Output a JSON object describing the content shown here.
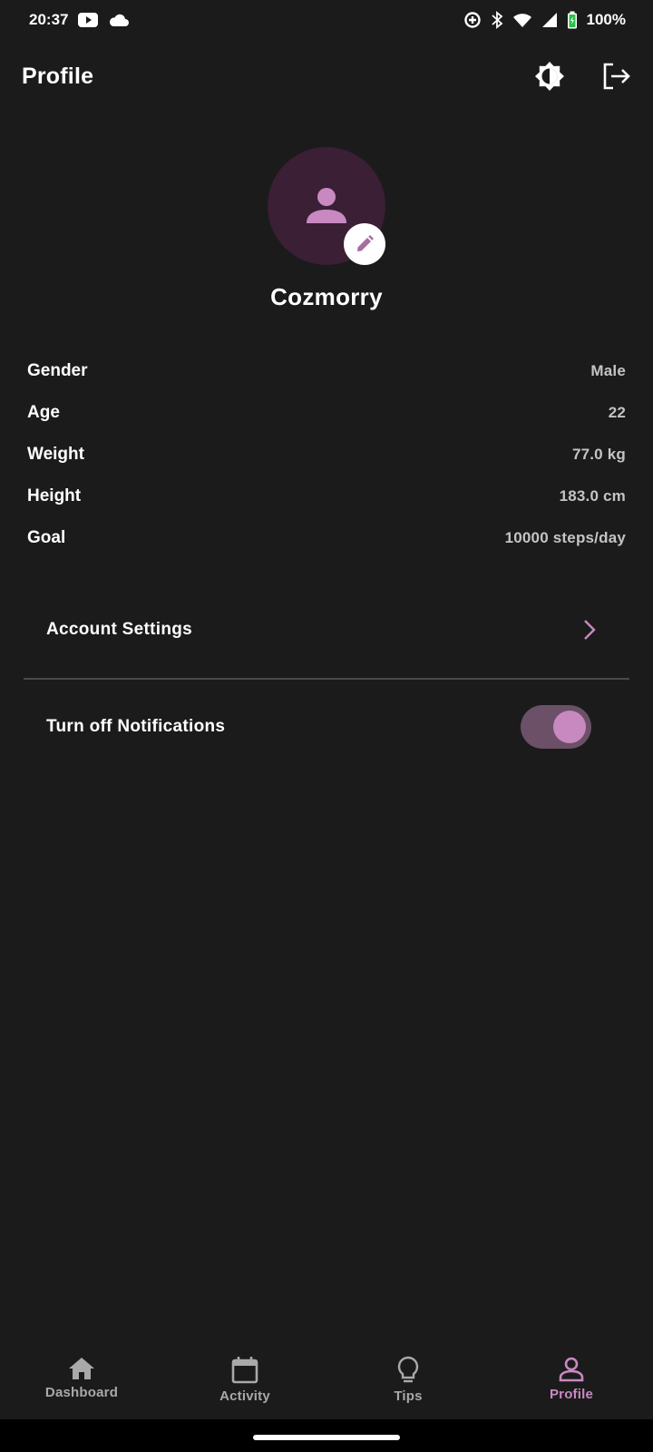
{
  "status_bar": {
    "time": "20:37",
    "battery": "100%",
    "icons_left": [
      "youtube-icon",
      "cloud-icon"
    ],
    "icons_right": [
      "data-saver-icon",
      "bluetooth-icon",
      "wifi-icon",
      "signal-icon",
      "battery-icon"
    ]
  },
  "app_bar": {
    "title": "Profile",
    "actions": [
      "brightness-icon",
      "logout-icon"
    ]
  },
  "profile": {
    "username": "Cozmorry",
    "avatar_icon": "person-icon",
    "edit_icon": "pencil-icon"
  },
  "info": [
    {
      "label": "Gender",
      "value": "Male"
    },
    {
      "label": "Age",
      "value": "22"
    },
    {
      "label": "Weight",
      "value": "77.0 kg"
    },
    {
      "label": "Height",
      "value": "183.0 cm"
    },
    {
      "label": "Goal",
      "value": "10000 steps/day"
    }
  ],
  "settings": {
    "account_label": "Account Settings",
    "notifications_label": "Turn off Notifications",
    "notifications_toggle_on": true
  },
  "bottom_nav": [
    {
      "label": "Dashboard",
      "icon": "home-icon",
      "active": false
    },
    {
      "label": "Activity",
      "icon": "calendar-icon",
      "active": false
    },
    {
      "label": "Tips",
      "icon": "lightbulb-icon",
      "active": false
    },
    {
      "label": "Profile",
      "icon": "person-outline-icon",
      "active": true
    }
  ],
  "colors": {
    "background": "#1b1b1b",
    "accent": "#c889c0",
    "avatar_bg": "#3a1f35",
    "toggle_track": "#6b5068"
  }
}
